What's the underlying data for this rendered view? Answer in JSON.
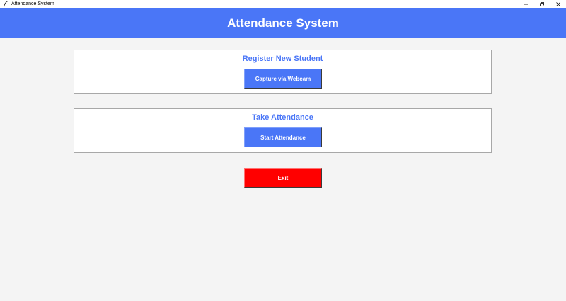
{
  "window": {
    "title": "Attendance System",
    "icons": {
      "app": "feather-icon",
      "minimize": "minimize-icon",
      "restore": "restore-icon",
      "close": "close-icon"
    }
  },
  "header": {
    "title": "Attendance System"
  },
  "register_panel": {
    "title": "Register New Student",
    "button_label": "Capture via Webcam"
  },
  "attendance_panel": {
    "title": "Take Attendance",
    "button_label": "Start Attendance"
  },
  "exit_button": {
    "label": "Exit"
  },
  "colors": {
    "accent": "#4a76f7",
    "exit": "#ff0000",
    "background": "#f4f4f4",
    "panel": "#ffffff"
  }
}
